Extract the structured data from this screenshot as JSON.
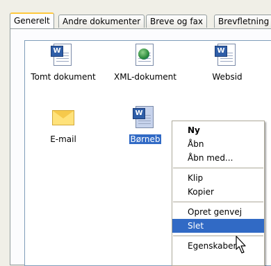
{
  "tabs": [
    {
      "label": "Generelt",
      "active": true
    },
    {
      "label": "Andre dokumenter",
      "active": false
    },
    {
      "label": "Breve og fax",
      "active": false
    },
    {
      "label": "Brevfletning",
      "active": false
    }
  ],
  "items": [
    {
      "label": "Tomt dokument",
      "icon": "word-document-icon"
    },
    {
      "label": "XML-dokument",
      "icon": "xml-document-icon"
    },
    {
      "label": "Websid",
      "icon": "web-page-icon"
    },
    {
      "label": "E-mail",
      "icon": "email-envelope-icon"
    },
    {
      "label": "Børneb",
      "icon": "word-template-icon",
      "selected": true
    }
  ],
  "context_menu": {
    "groups": [
      [
        "Ny",
        "Åbn",
        "Åbn med..."
      ],
      [
        "Klip",
        "Kopier"
      ],
      [
        "Opret genvej",
        "Slet"
      ],
      [
        "Egenskaber"
      ]
    ],
    "default_item": "Ny",
    "highlighted_item": "Slet"
  },
  "colors": {
    "selection": "#316ac5",
    "active_tab_accent": "#ffc83c",
    "background": "#f0efe7"
  }
}
